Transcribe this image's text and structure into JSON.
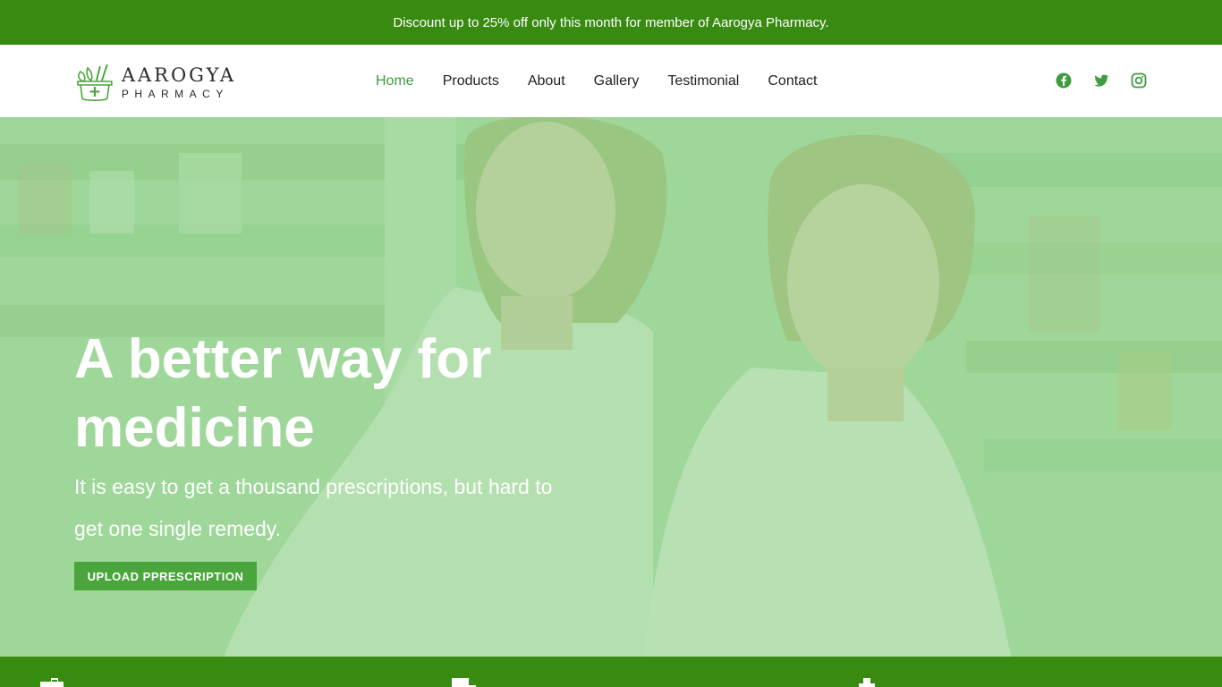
{
  "announcement": {
    "text": "Discount up to 25% off only this month for member of Aarogya Pharmacy."
  },
  "brand": {
    "name": "AAROGYA",
    "tagline": "PHARMACY"
  },
  "nav": {
    "items": [
      {
        "label": "Home",
        "active": true
      },
      {
        "label": "Products",
        "active": false
      },
      {
        "label": "About",
        "active": false
      },
      {
        "label": "Gallery",
        "active": false
      },
      {
        "label": "Testimonial",
        "active": false
      },
      {
        "label": "Contact",
        "active": false
      }
    ]
  },
  "social": {
    "icons": [
      "facebook-icon",
      "twitter-icon",
      "instagram-icon"
    ]
  },
  "hero": {
    "title": "A better way for medicine",
    "subtitle": "It is easy to get a thousand prescriptions, but hard to get one single remedy.",
    "cta_label": "UPLOAD PPRESCRIPTION"
  },
  "features": {
    "icons": [
      "medicine-bottle-icon",
      "document-icon",
      "medical-cross-icon"
    ]
  },
  "colors": {
    "primary_green": "#388a10",
    "accent_green": "#4aa63c",
    "nav_active": "#3e9b3e",
    "overlay_green": "#8cd287"
  }
}
